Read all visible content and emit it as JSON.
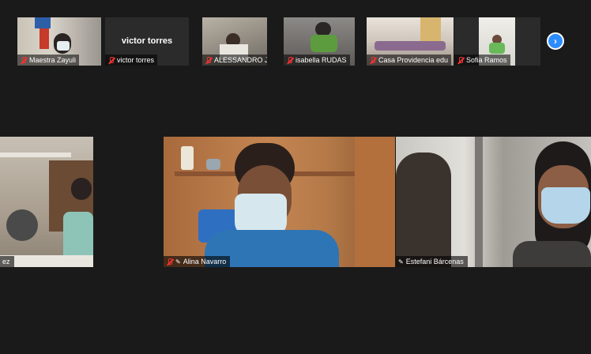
{
  "thumbnails": [
    {
      "name": "Maestra Zayuli",
      "muted": true
    },
    {
      "name": "victor torres",
      "muted": true,
      "video_off": true
    },
    {
      "name": "ALESSANDRO JOSE",
      "muted": true
    },
    {
      "name": "isabella RUDAS",
      "muted": true
    },
    {
      "name": "Casa Providencia edu",
      "muted": true
    },
    {
      "name": "Sofia Ramos",
      "muted": true
    }
  ],
  "next_page_label": "›",
  "gallery": [
    {
      "name": "ez",
      "muted": false
    },
    {
      "name": "Alina Navarro",
      "muted": true,
      "pinned": true
    },
    {
      "name": "Estefani Bárcenas",
      "muted": false,
      "pinned": true,
      "active_speaker": true
    }
  ],
  "colors": {
    "background": "#1a1a1a",
    "accent": "#2d8cff",
    "muted": "#e33333",
    "active_border": "#d8e97d"
  }
}
